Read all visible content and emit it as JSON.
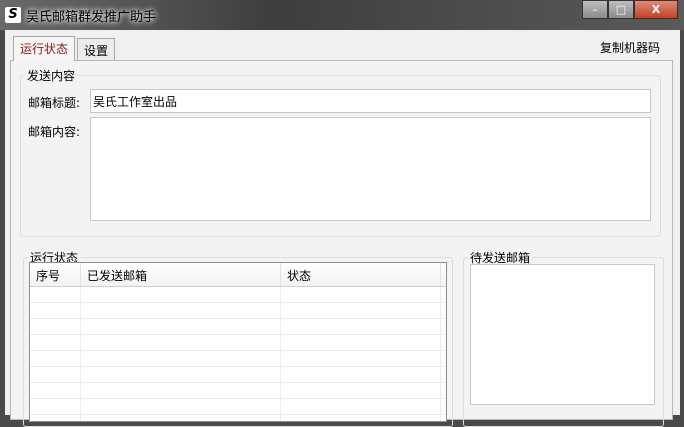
{
  "window": {
    "title": "吴氏邮箱群发推广助手",
    "icon": "S",
    "min": "–",
    "max": "□",
    "close": "X"
  },
  "tabs": [
    {
      "label": "运行状态",
      "active": true
    },
    {
      "label": "设置",
      "active": false
    }
  ],
  "copy_machine_code": "复制机器码",
  "send_content": {
    "title": "发送内容",
    "subject_label": "邮箱标题:",
    "subject_value": "吴氏工作室出品",
    "body_label": "邮箱内容:",
    "body_value": ""
  },
  "run_status": {
    "title": "运行状态",
    "columns": [
      "序号",
      "已发送邮箱",
      "状态"
    ],
    "rows": []
  },
  "pending": {
    "title": "待发送邮箱",
    "items": []
  }
}
